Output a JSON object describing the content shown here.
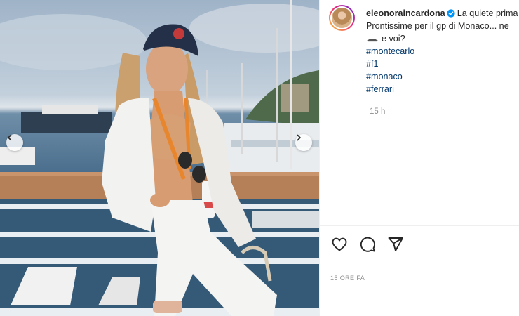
{
  "post": {
    "username": "eleonoraincardona",
    "caption_line1": "La quiete prima",
    "caption_line2": "Prontissime per il gp di Monaco... ne",
    "caption_line3": "e voi?",
    "hashtags": [
      "#montecarlo",
      "#f1",
      "#monaco",
      "#ferrari"
    ],
    "caption_time": "15 h",
    "post_date": "15 ORE FA"
  },
  "icons": {
    "verified": "verified-badge-icon",
    "like": "heart-icon",
    "comment": "comment-bubble-icon",
    "share": "paper-plane-icon",
    "prev": "chevron-left-icon",
    "next": "chevron-right-icon"
  },
  "colors": {
    "link": "#00376b",
    "verified": "#0095f6",
    "muted": "#8e8e8e",
    "text": "#262626"
  }
}
